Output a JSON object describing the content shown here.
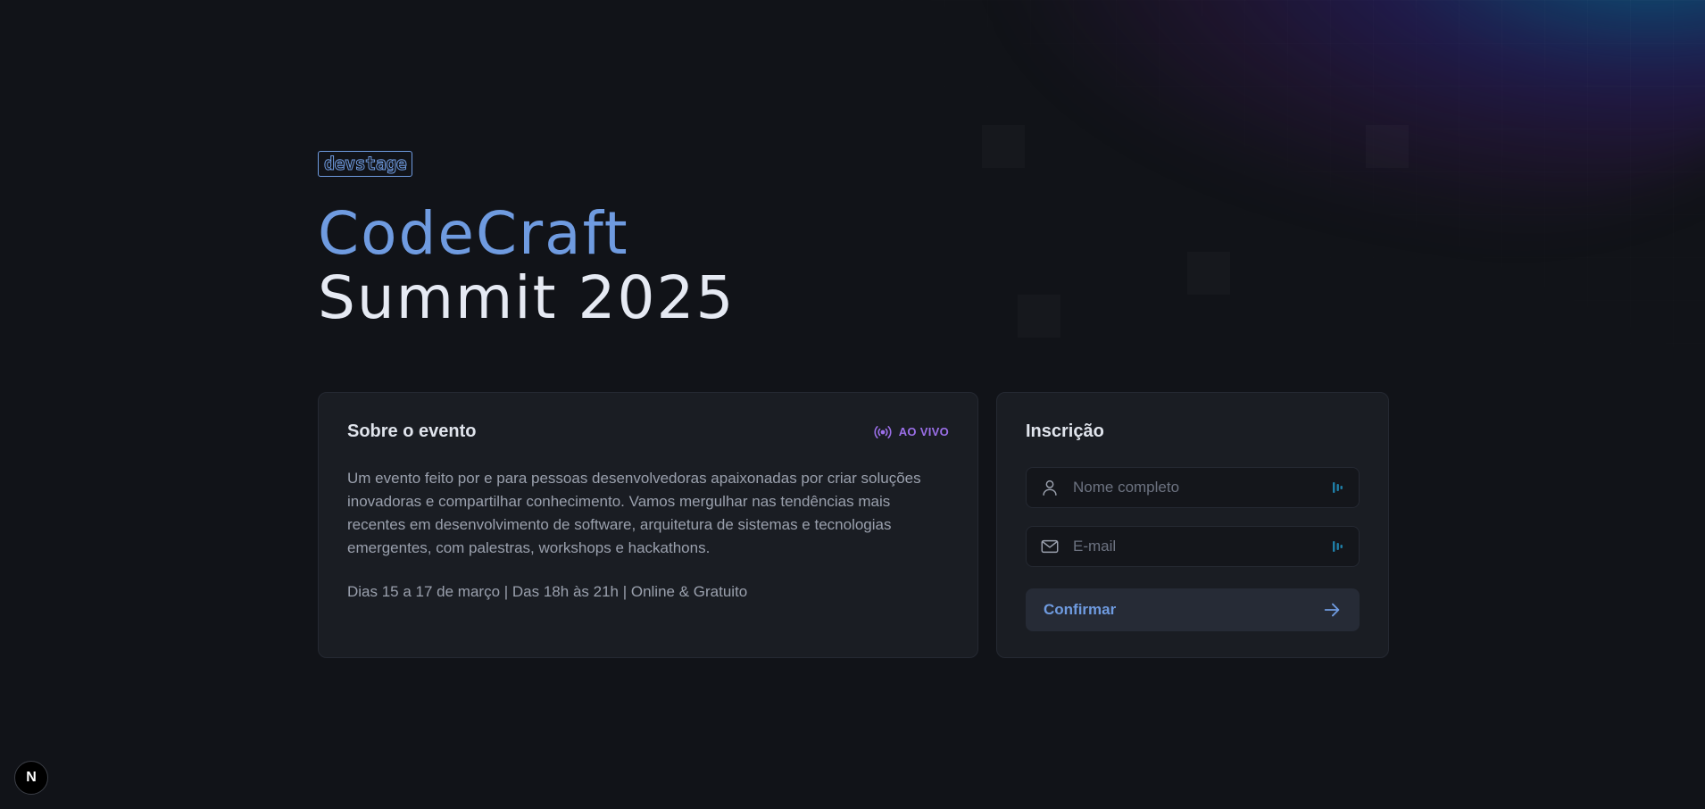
{
  "brand": {
    "logo_text": "devstage"
  },
  "hero": {
    "title_line1": "CodeCraft",
    "title_line2": "Summit 2025"
  },
  "about": {
    "title": "Sobre o evento",
    "live_label": "AO VIVO",
    "description": "Um evento feito por e para pessoas desenvolvedoras apaixonadas por criar soluções inovadoras e compartilhar conhecimento. Vamos mergulhar nas tendências mais recentes em desenvolvimento de software, arquitetura de sistemas e tecnologias emergentes, com palestras, workshops e hackathons.",
    "schedule": "Dias 15 a 17 de março | Das 18h às 21h | Online & Gratuito"
  },
  "signup": {
    "title": "Inscrição",
    "name_placeholder": "Nome completo",
    "email_placeholder": "E-mail",
    "confirm_label": "Confirmar"
  },
  "dev_badge": {
    "label": "N"
  },
  "colors": {
    "background": "#111318",
    "accent_blue": "#6f9be0",
    "live_purple": "#9b6fe8",
    "card": "#1a1d23"
  },
  "icons": {
    "live": "broadcast-icon",
    "name_field": "user-icon",
    "email_field": "mail-icon",
    "password_manager": "password-manager-icon",
    "confirm": "arrow-right-icon"
  }
}
